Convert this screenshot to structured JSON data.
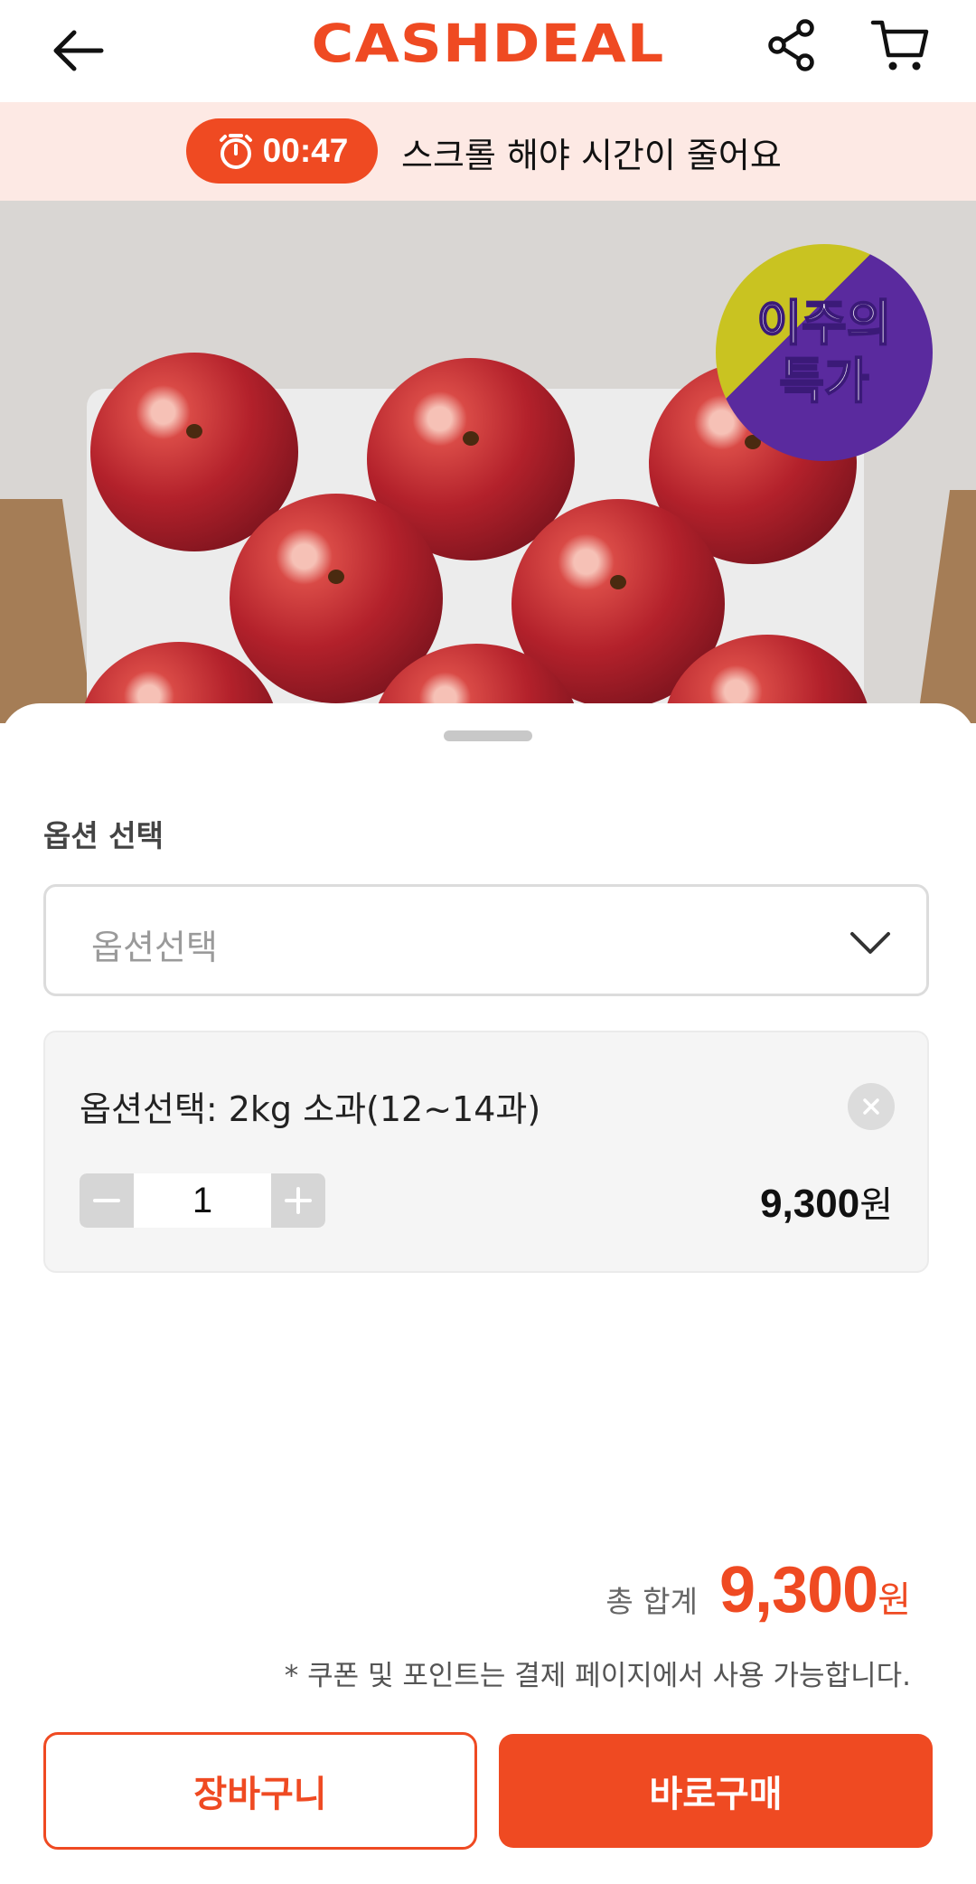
{
  "header": {
    "logo": "CASHDEAL",
    "back_icon": "arrow-left-icon",
    "share_icon": "share-icon",
    "cart_icon": "cart-icon"
  },
  "timer": {
    "time": "00:47",
    "icon": "stopwatch-icon",
    "message": "스크롤 해야 시간이 줄어요"
  },
  "product": {
    "badge_line1": "이주의",
    "badge_line2": "특가"
  },
  "option_sheet": {
    "section_label": "옵션 선택",
    "select_placeholder": "옵션선택",
    "selected_option": {
      "name": "옵션선택: 2kg 소과(12~14과)",
      "quantity": "1",
      "price": "9,300",
      "price_unit": "원"
    },
    "total_label": "총 합계",
    "total_amount": "9,300",
    "total_unit": "원",
    "notice": "* 쿠폰 및 포인트는 결제 페이지에서 사용 가능합니다.",
    "cart_button": "장바구니",
    "buy_button": "바로구매"
  },
  "colors": {
    "brand": "#ef4a22",
    "banner_bg": "#fde9e4"
  }
}
